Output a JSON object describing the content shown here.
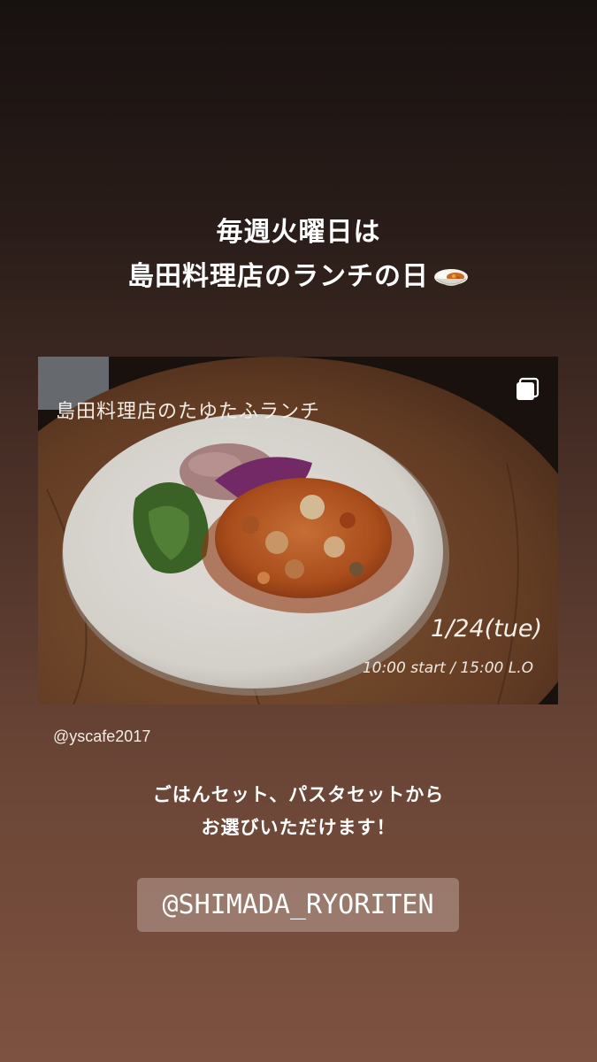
{
  "headline": {
    "line1": "毎週火曜日は",
    "line2": "島田料理店のランチの日"
  },
  "emoji": {
    "icon": "curry-rice-icon"
  },
  "post": {
    "overlay_title": "島田料理店のたゆたふランチ",
    "date": "1/24(tue)",
    "time": "10:00 start / 15:00 L.O",
    "multi_icon": "carousel-icon"
  },
  "post_author": "@yscafe2017",
  "subtext": {
    "line1": "ごはんセット、パスタセットから",
    "line2": "お選びいただけます！"
  },
  "mention_sticker": "@SHIMADA_RYORITEN"
}
